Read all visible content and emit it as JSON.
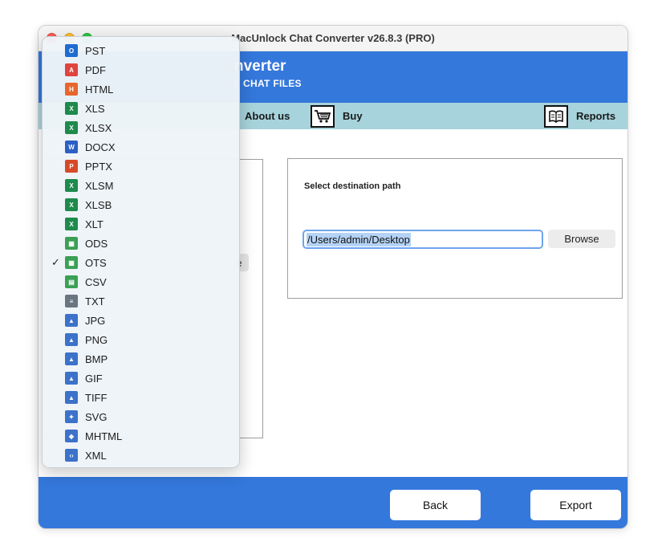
{
  "window": {
    "title": "MacUnlock Chat Converter v26.8.3 (PRO)"
  },
  "banner": {
    "title": "nverter",
    "subtitle": "L CHAT FILES"
  },
  "menubar": {
    "about_label": "About us",
    "buy_label": "Buy",
    "reports_label": "Reports"
  },
  "left_panel": {
    "button_stub": "e"
  },
  "destination": {
    "label": "Select destination path",
    "path_value": "/Users/admin/Desktop",
    "browse_label": "Browse"
  },
  "footer": {
    "back_label": "Back",
    "export_label": "Export"
  },
  "format_menu": {
    "selected": "OTS",
    "items": [
      {
        "label": "PST",
        "icon": "outlook-pst-icon",
        "color": "#1f6bd1",
        "glyph": "O",
        "checked": ""
      },
      {
        "label": "PDF",
        "icon": "pdf-icon",
        "color": "#e0443e",
        "glyph": "A",
        "checked": ""
      },
      {
        "label": "HTML",
        "icon": "html-icon",
        "color": "#e8662b",
        "glyph": "H",
        "checked": ""
      },
      {
        "label": "XLS",
        "icon": "excel-xls-icon",
        "color": "#1e8a4c",
        "glyph": "X",
        "checked": ""
      },
      {
        "label": "XLSX",
        "icon": "excel-xlsx-icon",
        "color": "#1e8a4c",
        "glyph": "X",
        "checked": ""
      },
      {
        "label": "DOCX",
        "icon": "word-docx-icon",
        "color": "#2b5fc4",
        "glyph": "W",
        "checked": ""
      },
      {
        "label": "PPTX",
        "icon": "powerpoint-pptx-icon",
        "color": "#d64a29",
        "glyph": "P",
        "checked": ""
      },
      {
        "label": "XLSM",
        "icon": "excel-xlsm-icon",
        "color": "#1e8a4c",
        "glyph": "X",
        "checked": ""
      },
      {
        "label": "XLSB",
        "icon": "excel-xlsb-icon",
        "color": "#1e8a4c",
        "glyph": "X",
        "checked": ""
      },
      {
        "label": "XLT",
        "icon": "excel-xlt-icon",
        "color": "#1e8a4c",
        "glyph": "X",
        "checked": ""
      },
      {
        "label": "ODS",
        "icon": "ods-sheet-icon",
        "color": "#3aa055",
        "glyph": "▦",
        "checked": ""
      },
      {
        "label": "OTS",
        "icon": "ots-sheet-icon",
        "color": "#3aa055",
        "glyph": "▦",
        "checked": "✓"
      },
      {
        "label": "CSV",
        "icon": "csv-icon",
        "color": "#3aa055",
        "glyph": "▤",
        "checked": ""
      },
      {
        "label": "TXT",
        "icon": "txt-file-icon",
        "color": "#6b7580",
        "glyph": "≡",
        "checked": ""
      },
      {
        "label": "JPG",
        "icon": "jpg-image-icon",
        "color": "#3c72c9",
        "glyph": "▲",
        "checked": ""
      },
      {
        "label": "PNG",
        "icon": "png-image-icon",
        "color": "#3c72c9",
        "glyph": "▲",
        "checked": ""
      },
      {
        "label": "BMP",
        "icon": "bmp-image-icon",
        "color": "#3c72c9",
        "glyph": "▲",
        "checked": ""
      },
      {
        "label": "GIF",
        "icon": "gif-image-icon",
        "color": "#3c72c9",
        "glyph": "▲",
        "checked": ""
      },
      {
        "label": "TIFF",
        "icon": "tiff-image-icon",
        "color": "#3c72c9",
        "glyph": "▲",
        "checked": ""
      },
      {
        "label": "SVG",
        "icon": "svg-image-icon",
        "color": "#3c72c9",
        "glyph": "✦",
        "checked": ""
      },
      {
        "label": "MHTML",
        "icon": "mhtml-icon",
        "color": "#3c72c9",
        "glyph": "◈",
        "checked": ""
      },
      {
        "label": "XML",
        "icon": "xml-file-icon",
        "color": "#3c72c9",
        "glyph": "‹›",
        "checked": ""
      }
    ]
  },
  "colors": {
    "brand_blue": "#3478dc",
    "menubar_teal": "#a6d3dc"
  }
}
